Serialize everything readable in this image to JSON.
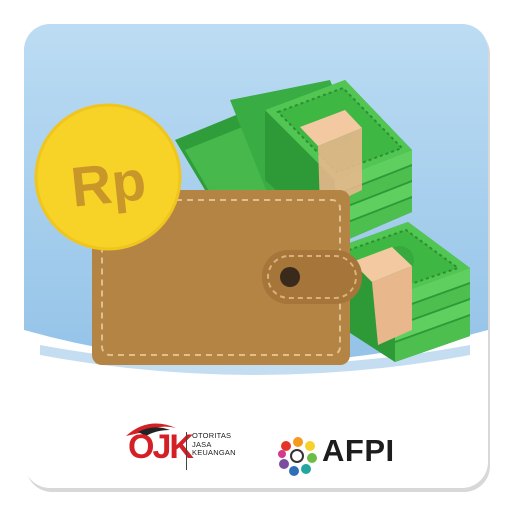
{
  "app_icon": {
    "currency_symbol": "Rp",
    "colors": {
      "background_sky": "#a9d1ee",
      "coin": "#f7d327",
      "coin_text": "#c9962a",
      "wallet": "#b48444",
      "wallet_flap": "#a5753a",
      "cash": "#3fb843",
      "cash_band": "#f3c9a2",
      "frame_bottom": "#ffffff"
    }
  },
  "logos": {
    "ojk": {
      "letters": "OJK",
      "line1": "OTORITAS",
      "line2": "JASA",
      "line3": "KEUANGAN",
      "brand_color": "#d41f26"
    },
    "afpi": {
      "text": "AFPI"
    }
  }
}
